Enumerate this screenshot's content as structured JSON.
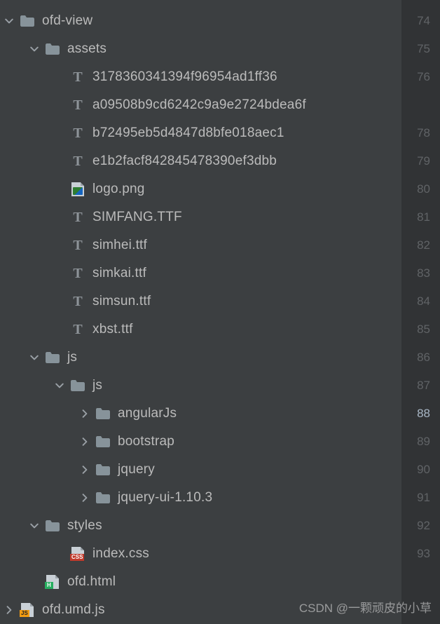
{
  "tree": [
    {
      "depth": 0,
      "arrow": "down",
      "icon": "folder",
      "label": "ofd-view"
    },
    {
      "depth": 1,
      "arrow": "down",
      "icon": "folder",
      "label": "assets"
    },
    {
      "depth": 2,
      "arrow": "none",
      "icon": "font",
      "label": "3178360341394f96954ad1ff36"
    },
    {
      "depth": 2,
      "arrow": "none",
      "icon": "font",
      "label": "a09508b9cd6242c9a9e2724bdea6f"
    },
    {
      "depth": 2,
      "arrow": "none",
      "icon": "font",
      "label": "b72495eb5d4847d8bfe018aec1"
    },
    {
      "depth": 2,
      "arrow": "none",
      "icon": "font",
      "label": "e1b2facf842845478390ef3dbb"
    },
    {
      "depth": 2,
      "arrow": "none",
      "icon": "image",
      "label": "logo.png"
    },
    {
      "depth": 2,
      "arrow": "none",
      "icon": "font",
      "label": "SIMFANG.TTF"
    },
    {
      "depth": 2,
      "arrow": "none",
      "icon": "font",
      "label": "simhei.ttf"
    },
    {
      "depth": 2,
      "arrow": "none",
      "icon": "font",
      "label": "simkai.ttf"
    },
    {
      "depth": 2,
      "arrow": "none",
      "icon": "font",
      "label": "simsun.ttf"
    },
    {
      "depth": 2,
      "arrow": "none",
      "icon": "font",
      "label": "xbst.ttf"
    },
    {
      "depth": 1,
      "arrow": "down",
      "icon": "folder",
      "label": "js"
    },
    {
      "depth": 2,
      "arrow": "down",
      "icon": "folder",
      "label": "js"
    },
    {
      "depth": 3,
      "arrow": "right",
      "icon": "folder",
      "label": "angularJs"
    },
    {
      "depth": 3,
      "arrow": "right",
      "icon": "folder",
      "label": "bootstrap"
    },
    {
      "depth": 3,
      "arrow": "right",
      "icon": "folder",
      "label": "jquery"
    },
    {
      "depth": 3,
      "arrow": "right",
      "icon": "folder",
      "label": "jquery-ui-1.10.3"
    },
    {
      "depth": 1,
      "arrow": "down",
      "icon": "folder",
      "label": "styles"
    },
    {
      "depth": 2,
      "arrow": "none",
      "icon": "css",
      "label": "index.css"
    },
    {
      "depth": 1,
      "arrow": "none",
      "icon": "html",
      "label": "ofd.html"
    },
    {
      "depth": 0,
      "arrow": "right",
      "icon": "js",
      "label": "ofd.umd.js"
    }
  ],
  "gutter": {
    "numbers": [
      74,
      75,
      76,
      null,
      78,
      79,
      80,
      81,
      82,
      83,
      84,
      85,
      86,
      87,
      88,
      89,
      90,
      91,
      92,
      93
    ],
    "active": 88
  },
  "watermark": "CSDN @一颗顽皮的小草"
}
